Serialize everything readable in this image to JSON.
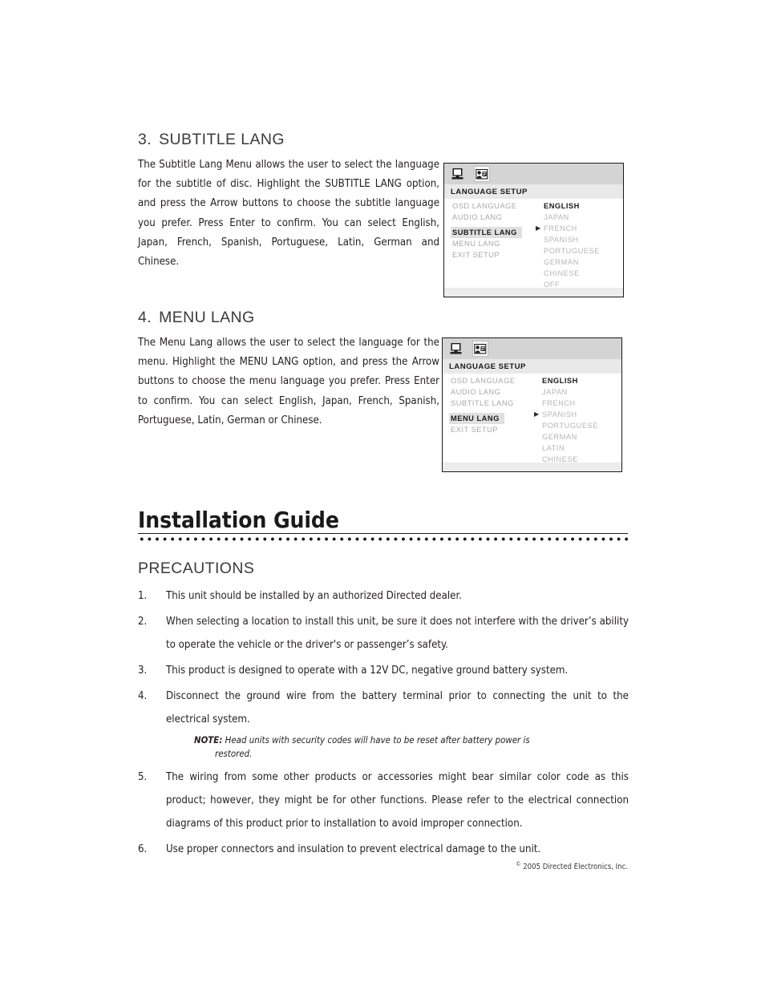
{
  "sections": [
    {
      "number": "3.",
      "title": "SUBTITLE LANG",
      "body": "The Subtitle Lang Menu allows the user to select the language for the subtitle of disc. Highlight the SUBTITLE LANG option, and press the Arrow buttons to choose the subtitle language you prefer. Press Enter to confirm. You can select English, Japan, French, Spanish, Portuguese, Latin, German and Chinese."
    },
    {
      "number": "4.",
      "title": "MENU LANG",
      "body": "The Menu Lang allows the user to select the language for the menu. Highlight the MENU LANG option, and press the Arrow buttons to choose the menu language you prefer. Press Enter to confirm. You can select English, Japan, French, Spanish, Portuguese, Latin, German or Chinese."
    }
  ],
  "osd_panels": [
    {
      "icons": [
        "display-icon",
        "language-icon"
      ],
      "active_icon_index": 1,
      "title": "LANGUAGE  SETUP",
      "menu_items": [
        {
          "label": "OSD  LANGUAGE",
          "selected": false
        },
        {
          "label": "AUDIO  LANG",
          "selected": false
        },
        {
          "label": "SUBTITLE LANG",
          "selected": true
        },
        {
          "label": "MENU  LANG",
          "selected": false
        },
        {
          "label": "EXIT  SETUP",
          "selected": false
        }
      ],
      "options": [
        {
          "label": "ENGLISH",
          "current": true,
          "caret": false
        },
        {
          "label": "JAPAN",
          "current": false,
          "caret": false
        },
        {
          "label": "FRENCH",
          "current": false,
          "caret": true
        },
        {
          "label": "SPANISH",
          "current": false,
          "caret": false
        },
        {
          "label": "PORTUGUESE",
          "current": false,
          "caret": false
        },
        {
          "label": "GERMAN",
          "current": false,
          "caret": false
        },
        {
          "label": "CHINESE",
          "current": false,
          "caret": false
        },
        {
          "label": "OFF",
          "current": false,
          "caret": false
        }
      ]
    },
    {
      "icons": [
        "display-icon",
        "language-icon"
      ],
      "active_icon_index": 1,
      "title": "LANGUAGE  SETUP",
      "menu_items": [
        {
          "label": "OSD  LANGUAGE",
          "selected": false
        },
        {
          "label": "AUDIO  LANG",
          "selected": false
        },
        {
          "label": "SUBTITLE LANG",
          "selected": false
        },
        {
          "label": "MENU  LANG",
          "selected": true
        },
        {
          "label": "EXIT  SETUP",
          "selected": false
        }
      ],
      "options": [
        {
          "label": "ENGLISH",
          "current": true,
          "caret": false
        },
        {
          "label": "JAPAN",
          "current": false,
          "caret": false
        },
        {
          "label": "FRENCH",
          "current": false,
          "caret": false
        },
        {
          "label": "SPANISH",
          "current": false,
          "caret": true
        },
        {
          "label": "PORTUGUESE",
          "current": false,
          "caret": false
        },
        {
          "label": "GERMAN",
          "current": false,
          "caret": false
        },
        {
          "label": "LATIN",
          "current": false,
          "caret": false
        },
        {
          "label": "CHINESE",
          "current": false,
          "caret": false
        }
      ]
    }
  ],
  "guide": {
    "title": "Installation Guide"
  },
  "precautions": {
    "heading": "PRECAUTIONS",
    "items": [
      {
        "marker": "1.",
        "text": "This unit should be installed by an authorized Directed dealer.",
        "justify": false
      },
      {
        "marker": "2.",
        "text": "When selecting a location to install this unit, be sure it does not interfere with the driver’s ability to operate the vehicle or the driver's or passenger’s safety.",
        "justify": true
      },
      {
        "marker": "3.",
        "text": "This product is designed to operate with a 12V DC, negative ground battery system.",
        "justify": false
      },
      {
        "marker": "4.",
        "text": "Disconnect the ground wire from the battery terminal prior to connecting the unit to the electrical system.",
        "justify": true
      },
      {
        "marker": "5.",
        "text": "The wiring from some other products or accessories might bear similar color code as this product; however, they might be for other functions. Please refer to the electrical connection diagrams of this product prior to installation to avoid improper connection.",
        "justify": true
      },
      {
        "marker": "6.",
        "text": "Use proper connectors and insulation to prevent electrical damage to the unit.",
        "justify": false
      }
    ],
    "note": {
      "label": "NOTE:",
      "line1": "Head units with security codes will have to be reset after battery power is",
      "line2": "restored."
    }
  },
  "footer": {
    "symbol": "©",
    "text": "2005 Directed Electronics, Inc."
  }
}
